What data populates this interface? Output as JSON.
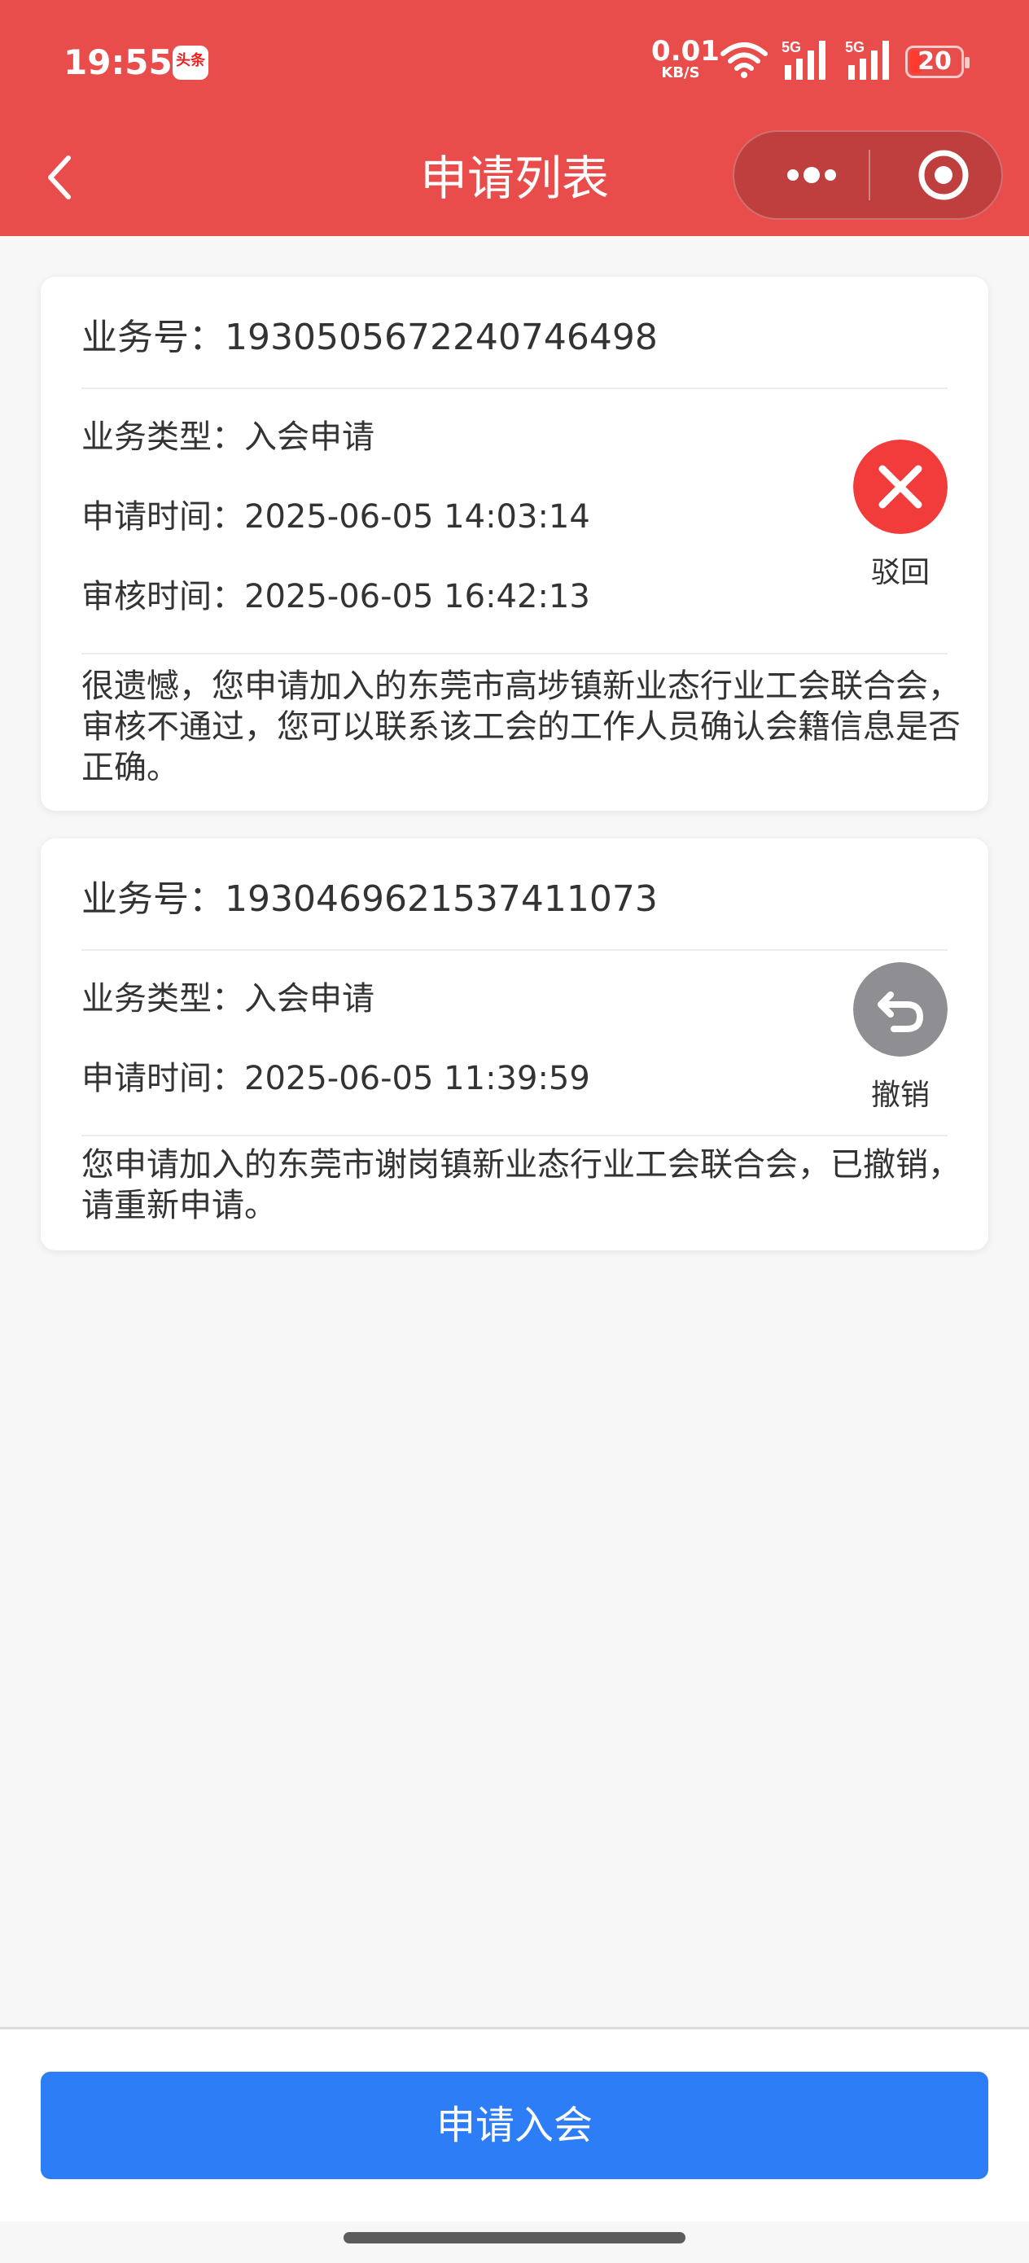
{
  "status_bar": {
    "time": "19:55",
    "app_badge": "头条",
    "net_speed_value": "0.01",
    "net_speed_unit": "KB/S",
    "signal1_label": "5G",
    "signal2_label": "5G",
    "battery": "20"
  },
  "navbar": {
    "title": "申请列表"
  },
  "applications": [
    {
      "business_no": "业务号：1930505672240746498",
      "type": "业务类型：入会申请",
      "apply_time": "申请时间：2025-06-05 14:03:14",
      "review_time": "审核时间：2025-06-05 16:42:13",
      "status": "驳回",
      "status_color": "#f23c3c",
      "status_icon": "reject-icon",
      "message": "很遗憾，您申请加入的东莞市高埗镇新业态行业工会联合会，审核不通过，您可以联系该工会的工作人员确认会籍信息是否正确。"
    },
    {
      "business_no": "业务号：1930469621537411073",
      "type": "业务类型：入会申请",
      "apply_time": "申请时间：2025-06-05 11:39:59",
      "status": "撤销",
      "status_color": "#8e8e93",
      "status_icon": "undo-icon",
      "message": "您申请加入的东莞市谢岗镇新业态行业工会联合会，已撤销，请重新申请。"
    }
  ],
  "bottom": {
    "apply_button": "申请入会"
  },
  "colors": {
    "header": "#e84d4b",
    "primary_button": "#2d7df6"
  }
}
